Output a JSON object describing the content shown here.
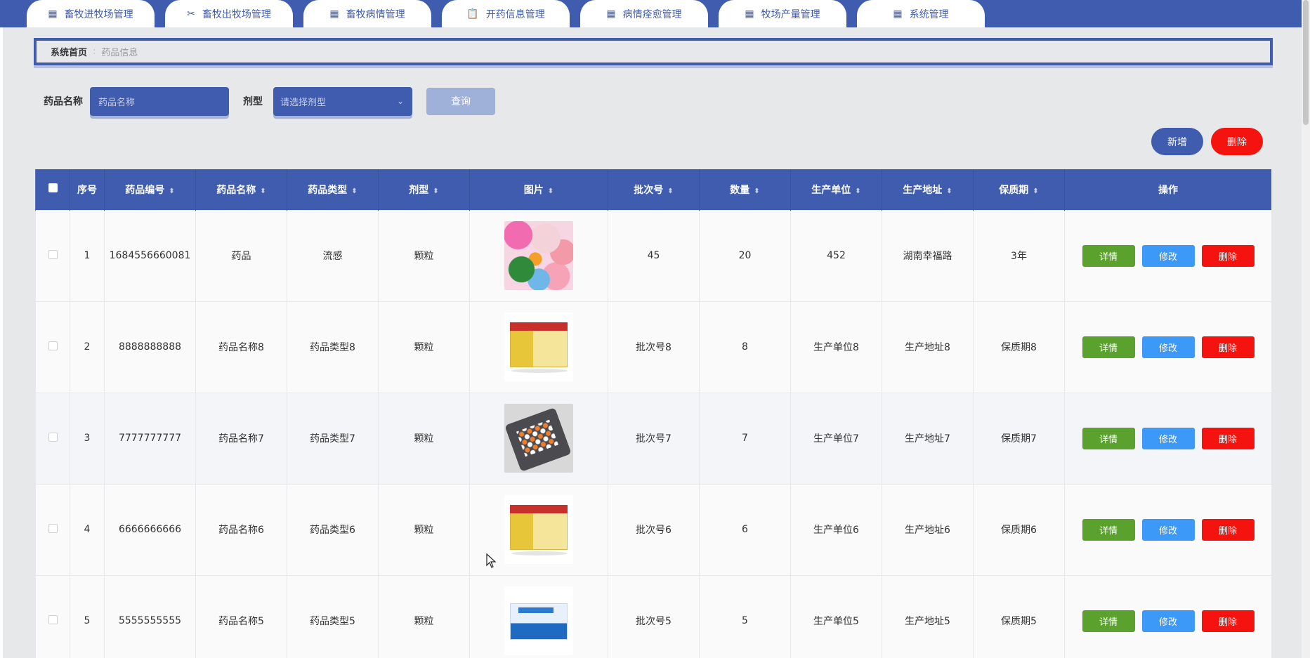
{
  "nav": {
    "tabs": [
      {
        "label": "畜牧进牧场管理",
        "icon": "grid-icon"
      },
      {
        "label": "畜牧出牧场管理",
        "icon": "ticket-icon"
      },
      {
        "label": "畜牧病情管理",
        "icon": "grid-icon"
      },
      {
        "label": "开药信息管理",
        "icon": "clipboard-icon"
      },
      {
        "label": "病情痊愈管理",
        "icon": "grid-icon"
      },
      {
        "label": "牧场产量管理",
        "icon": "grid-icon"
      },
      {
        "label": "系统管理",
        "icon": "grid-icon"
      }
    ]
  },
  "breadcrumb": {
    "home": "系统首页",
    "separator": ":",
    "current": "药品信息"
  },
  "search": {
    "name_label": "药品名称",
    "name_placeholder": "药品名称",
    "form_label": "剂型",
    "form_placeholder": "请选择剂型",
    "query_label": "查询"
  },
  "actions": {
    "add_label": "新增",
    "delete_label": "删除"
  },
  "table": {
    "headers": [
      "序号",
      "药品编号",
      "药品名称",
      "药品类型",
      "剂型",
      "图片",
      "批次号",
      "数量",
      "生产单位",
      "生产地址",
      "保质期",
      "操作"
    ],
    "row_actions": {
      "detail": "详情",
      "edit": "修改",
      "delete": "删除"
    },
    "rows": [
      {
        "index": "1",
        "code": "1684556660081",
        "name": "药品",
        "type": "流感",
        "form": "颗粒",
        "image": "pills-image",
        "batch": "45",
        "qty": "20",
        "maker": "452",
        "address": "湖南幸福路",
        "shelf": "3年"
      },
      {
        "index": "2",
        "code": "8888888888",
        "name": "药品名称8",
        "type": "药品类型8",
        "form": "颗粒",
        "image": "medicine-box-image",
        "batch": "批次号8",
        "qty": "8",
        "maker": "生产单位8",
        "address": "生产地址8",
        "shelf": "保质期8"
      },
      {
        "index": "3",
        "code": "7777777777",
        "name": "药品名称7",
        "type": "药品类型7",
        "form": "颗粒",
        "image": "pill-case-image",
        "batch": "批次号7",
        "qty": "7",
        "maker": "生产单位7",
        "address": "生产地址7",
        "shelf": "保质期7"
      },
      {
        "index": "4",
        "code": "6666666666",
        "name": "药品名称6",
        "type": "药品类型6",
        "form": "颗粒",
        "image": "medicine-box-image",
        "batch": "批次号6",
        "qty": "6",
        "maker": "生产单位6",
        "address": "生产地址6",
        "shelf": "保质期6"
      },
      {
        "index": "5",
        "code": "5555555555",
        "name": "药品名称5",
        "type": "药品类型5",
        "form": "颗粒",
        "image": "medicine-pack-image",
        "batch": "批次号5",
        "qty": "5",
        "maker": "生产单位5",
        "address": "生产地址5",
        "shelf": "保质期5"
      }
    ]
  },
  "colors": {
    "primary": "#3f5caf",
    "danger": "#f5130f",
    "success": "#5aa22d",
    "info": "#3d99f7"
  }
}
